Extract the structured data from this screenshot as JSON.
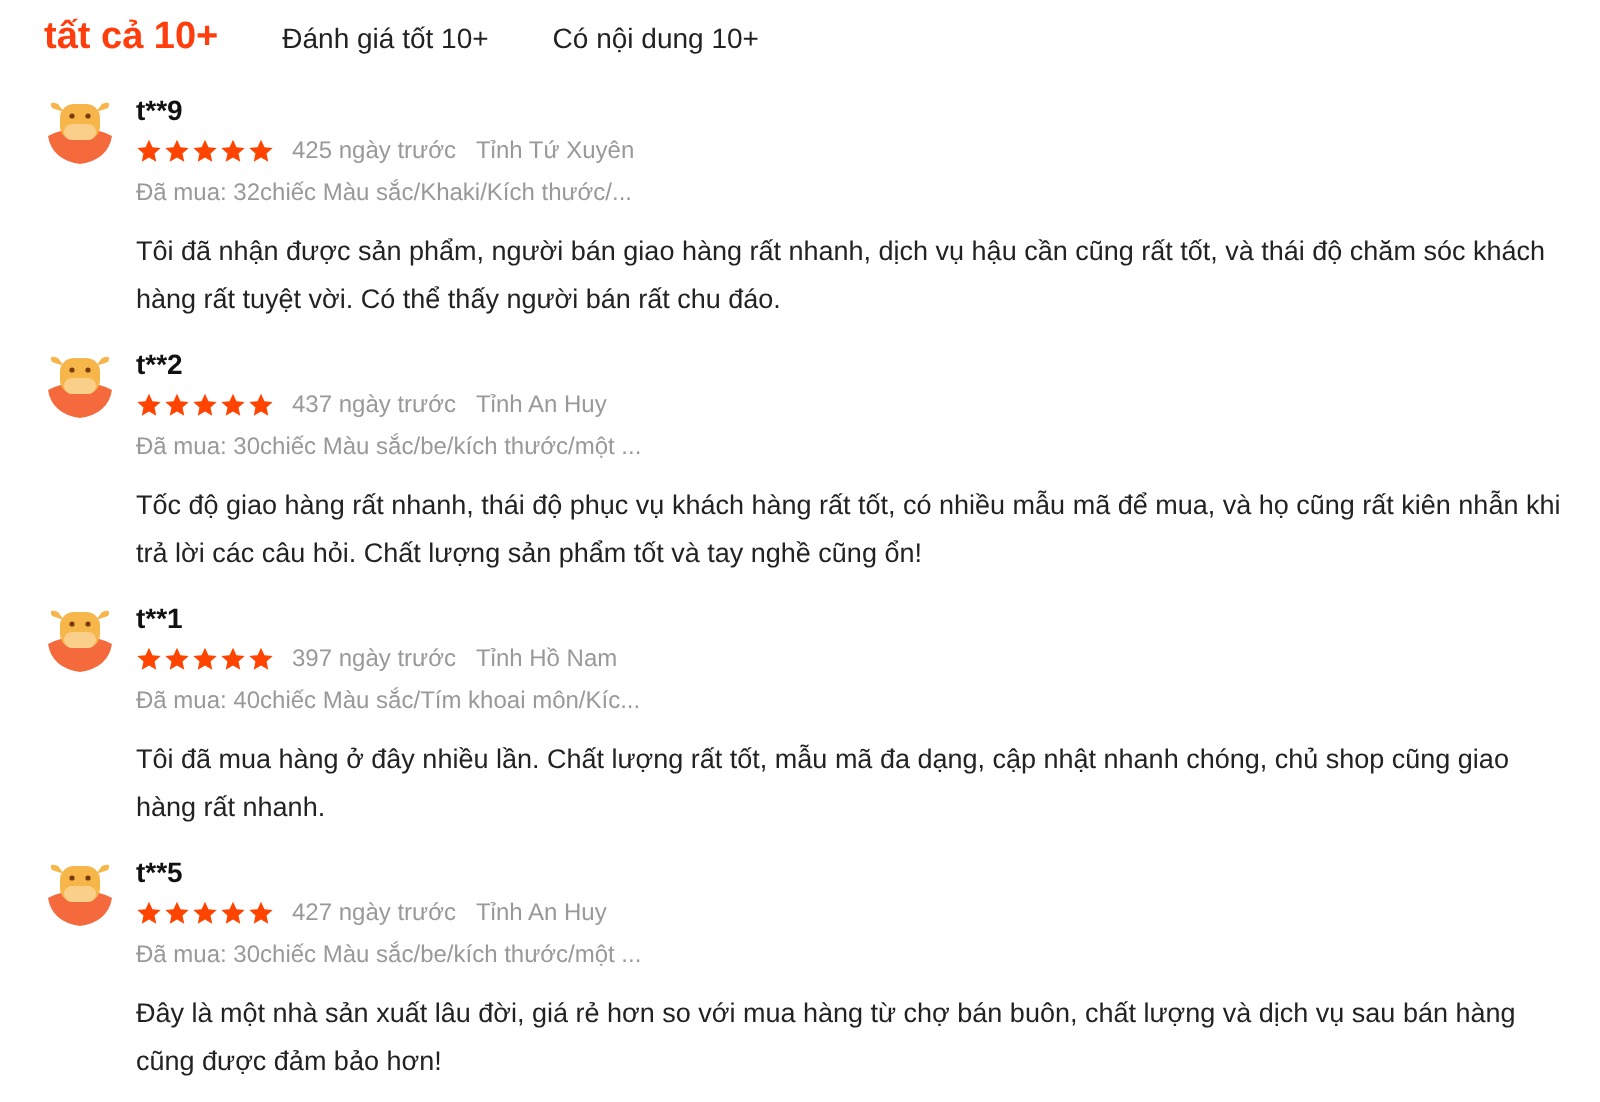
{
  "tabs": [
    {
      "label": "tất cả 10+",
      "selected": true
    },
    {
      "label": "Đánh giá tốt 10+",
      "selected": false
    },
    {
      "label": "Có nội dung 10+",
      "selected": false
    }
  ],
  "reviews": [
    {
      "user": "t**9",
      "stars": 5,
      "time": "425 ngày trước",
      "location": "Tỉnh Tứ Xuyên",
      "purchase": "Đã mua: 32chiếc Màu sắc/Khaki/Kích thước/...",
      "text": "Tôi đã nhận được sản phẩm, người bán giao hàng rất nhanh, dịch vụ hậu cần cũng rất tốt, và thái độ chăm sóc khách hàng rất tuyệt vời. Có thể thấy người bán rất chu đáo."
    },
    {
      "user": "t**2",
      "stars": 5,
      "time": "437 ngày trước",
      "location": "Tỉnh An Huy",
      "purchase": "Đã mua: 30chiếc Màu sắc/be/kích thước/một ...",
      "text": "Tốc độ giao hàng rất nhanh, thái độ phục vụ khách hàng rất tốt, có nhiều mẫu mã để mua, và họ cũng rất kiên nhẫn khi trả lời các câu hỏi. Chất lượng sản phẩm tốt và tay nghề cũng ổn!"
    },
    {
      "user": "t**1",
      "stars": 5,
      "time": "397 ngày trước",
      "location": "Tỉnh Hồ Nam",
      "purchase": "Đã mua: 40chiếc Màu sắc/Tím khoai môn/Kíc...",
      "text": "Tôi đã mua hàng ở đây nhiều lần. Chất lượng rất tốt, mẫu mã đa dạng, cập nhật nhanh chóng, chủ shop cũng giao hàng rất nhanh."
    },
    {
      "user": "t**5",
      "stars": 5,
      "time": "427 ngày trước",
      "location": "Tỉnh An Huy",
      "purchase": "Đã mua: 30chiếc Màu sắc/be/kích thước/một ...",
      "text": "Đây là một nhà sản xuất lâu đời, giá rẻ hơn so với mua hàng từ chợ bán buôn, chất lượng và dịch vụ sau bán hàng cũng được đảm bảo hơn!"
    }
  ]
}
